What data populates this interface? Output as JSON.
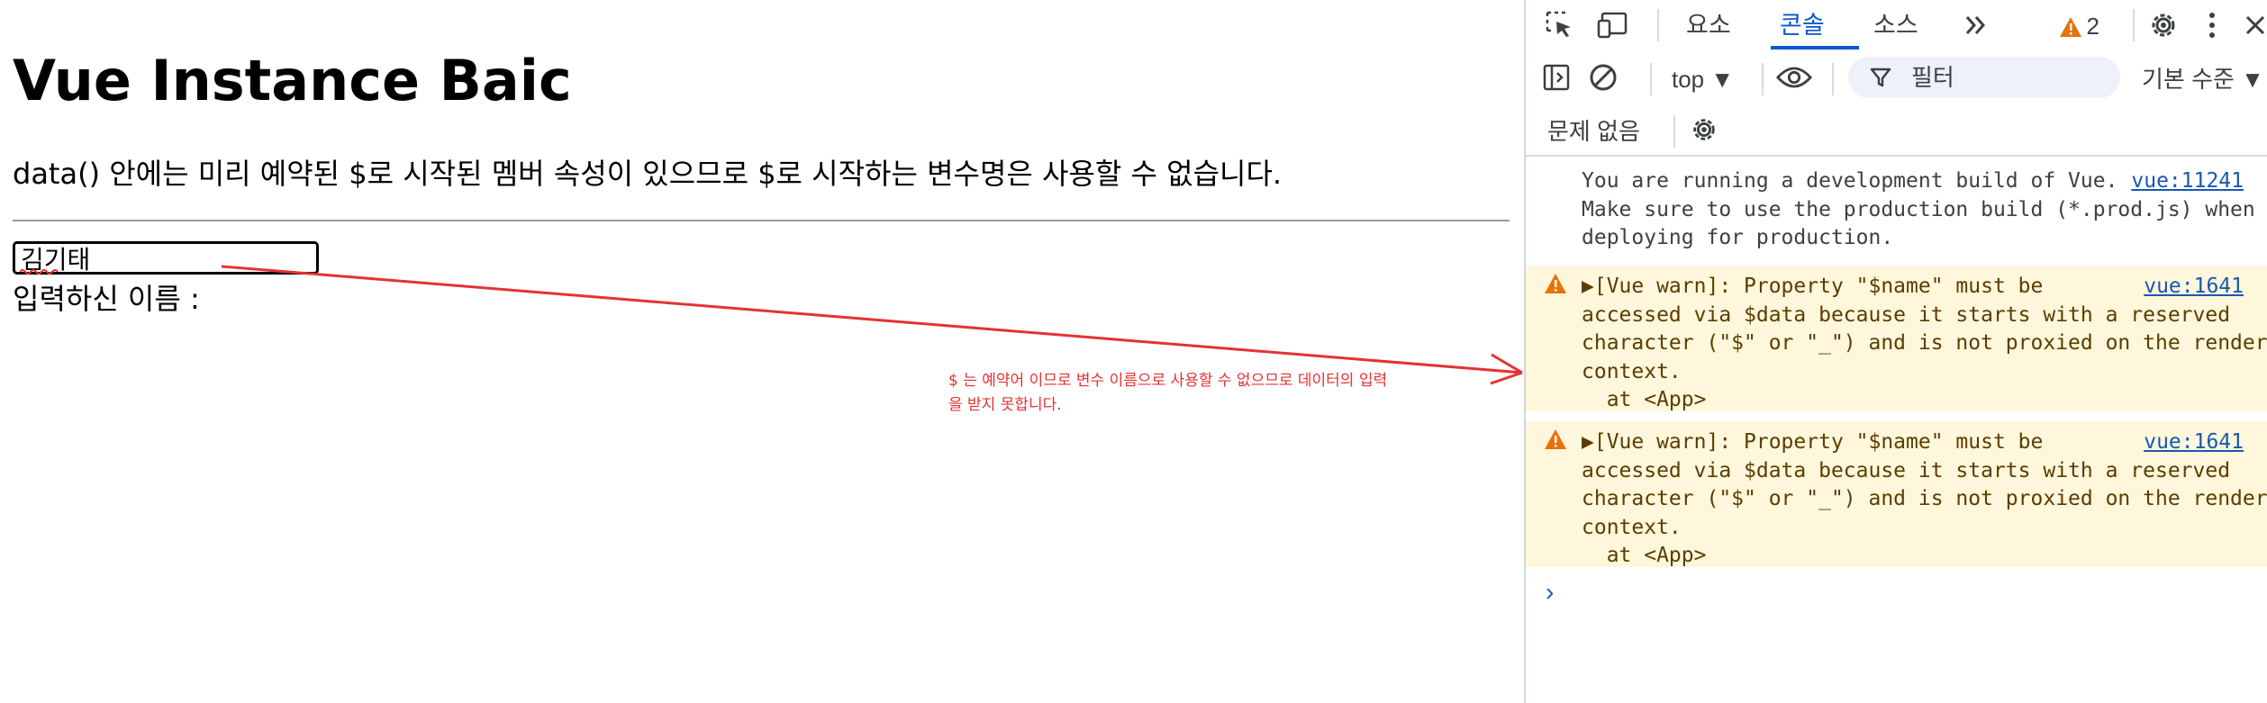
{
  "page": {
    "title": "Vue Instance Baic",
    "description": "data() 안에는 미리 예약된 $로 시작된 멤버 속성이 있으므로 $로 시작하는 변수명은 사용할 수 없습니다.",
    "input_value": "김기태",
    "display_label": "입력하신 이름 :",
    "annotation": "$ 는 예약어 이므로 변수 이름으로 사용할 수 없으므로 데이터의 입력을 받지 못합니다.",
    "annotation_color": "#e53232"
  },
  "devtools": {
    "tabs": [
      {
        "label": "요소",
        "active": false
      },
      {
        "label": "콘솔",
        "active": true
      },
      {
        "label": "소스",
        "active": false
      }
    ],
    "more_tabs_icon": "double-chevron-right-icon",
    "warning_count": "2",
    "toolbar": {
      "context": "top ▼",
      "filter_placeholder": "필터",
      "levels": "기본 수준 ▼"
    },
    "issues_label": "문제 없음",
    "accent_color": "#0b57d0",
    "warn_background": "#fef7db",
    "messages": [
      {
        "type": "info",
        "text": "You are running a development build of Vue.\nMake sure to use the production build (*.prod.js) when\ndeploying for production.",
        "source": "vue:11241"
      },
      {
        "type": "warning",
        "text": "▶[Vue warn]: Property \"$name\" must be\naccessed via $data because it starts with a reserved\ncharacter (\"$\" or \"_\") and is not proxied on the render\ncontext.\n  at <App>",
        "source": "vue:1641"
      },
      {
        "type": "warning",
        "text": "▶[Vue warn]: Property \"$name\" must be\naccessed via $data because it starts with a reserved\ncharacter (\"$\" or \"_\") and is not proxied on the render\ncontext.\n  at <App>",
        "source": "vue:1641"
      }
    ],
    "prompt_symbol": "›"
  }
}
